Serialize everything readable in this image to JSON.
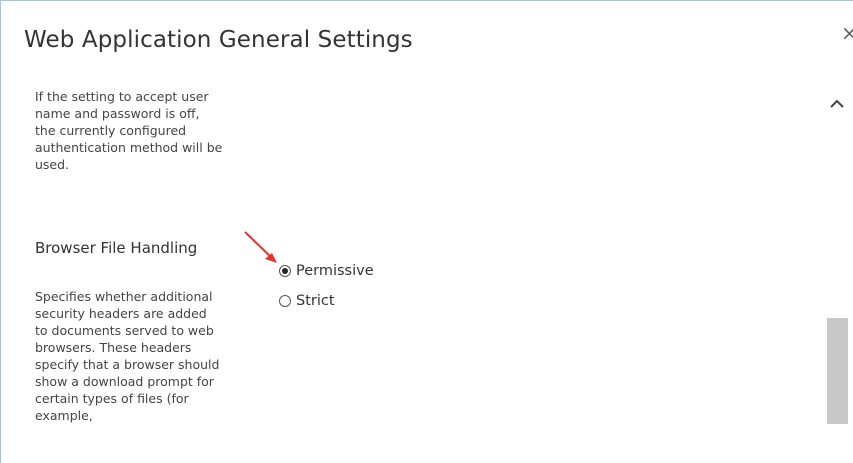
{
  "dialog": {
    "title": "Web Application General Settings",
    "close_glyph": "×"
  },
  "content": {
    "clipped_text": "~ ~",
    "auth_description": "If the setting to accept user name and password is off, the currently configured authentication method will be used.",
    "browser_file_handling": {
      "title": "Browser File Handling",
      "description": "Specifies whether additional security headers are added to documents served to web browsers. These headers specify that a browser should show a download prompt for certain types of files (for example,",
      "options": [
        {
          "label": "Permissive",
          "checked": true
        },
        {
          "label": "Strict",
          "checked": false
        }
      ]
    }
  },
  "annotation": {
    "arrow_color": "#e8322a"
  },
  "icons": {
    "close": "close-icon",
    "scroll_up": "chevron-up-icon",
    "arrow": "red-arrow-icon"
  }
}
